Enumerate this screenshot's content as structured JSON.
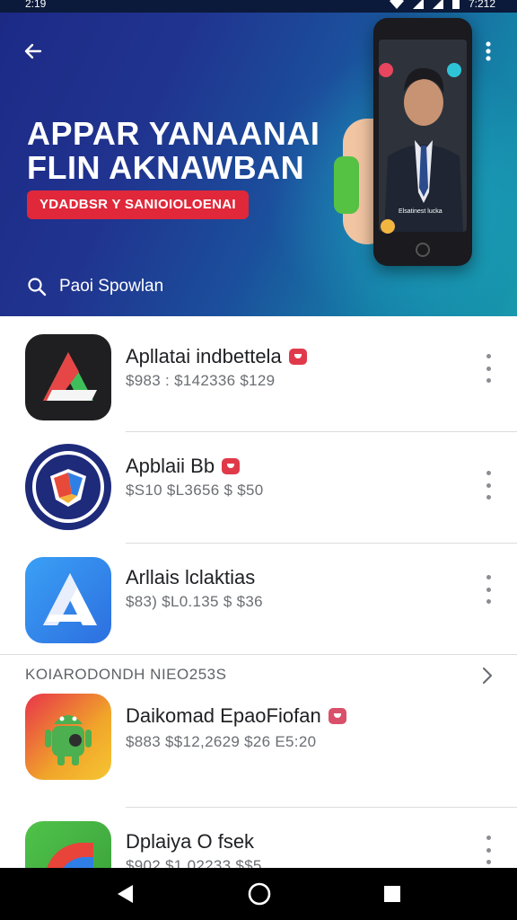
{
  "status_bar": {
    "time": "2:19",
    "right_time": "7:212",
    "icons": [
      "wifi-icon",
      "signal-icon",
      "signal-icon",
      "battery-icon"
    ]
  },
  "hero": {
    "title_line1": "APPAR YANAANAI",
    "title_line2": "FLIN AKNAWBAN",
    "badge": "YDADBSR Y SANIOIOLOENAI",
    "search_label": "Paoi Spowlan",
    "colors": {
      "gradient_start": "#1c2a86",
      "gradient_end": "#1798ad",
      "badge": "#e0283a"
    },
    "phone_caption": "Elsatinest lucka"
  },
  "apps": [
    {
      "name": "Apllatai indbettela",
      "price": "$983 : $142336 $129",
      "tagged": true
    },
    {
      "name": "Apblaii Bb",
      "price": "$S10 $L3656  $ $50",
      "tagged": true
    },
    {
      "name": "Arllais lclaktias",
      "price": "$83) $L0.135  $ $36",
      "tagged": false
    }
  ],
  "section": {
    "title": "KOIARODONDH NIEO253S"
  },
  "apps_2": [
    {
      "name": "Daikomad EpaoFiofan",
      "price": "$883 $$12,2629 $26 E5:20",
      "tagged": true
    },
    {
      "name": "Dplaiya O fsek",
      "price": "$902 $1,02233  $$5",
      "tagged": false
    }
  ],
  "nav": [
    "back-triangle-icon",
    "home-circle-icon",
    "recents-square-icon"
  ]
}
